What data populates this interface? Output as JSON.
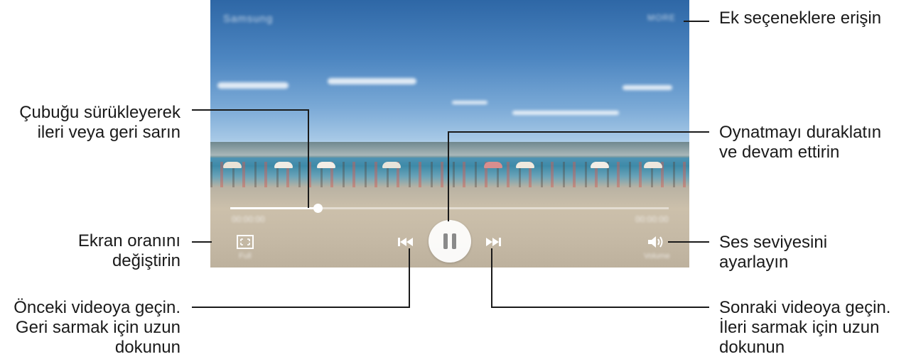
{
  "player": {
    "title": "Samsung",
    "more_label": "MORE",
    "elapsed": "00:00:00",
    "duration": "00:00:00",
    "ratio_label": "Full",
    "volume_label": "Volume",
    "progress_fraction": 0.2
  },
  "callouts": {
    "more": {
      "lines": [
        "Ek seçeneklere erişin"
      ]
    },
    "seek": {
      "lines": [
        "Çubuğu sürükleyerek",
        "ileri veya geri sarın"
      ]
    },
    "pause": {
      "lines": [
        "Oynatmayı duraklatın",
        "ve devam ettirin"
      ]
    },
    "ratio": {
      "lines": [
        "Ekran oranını",
        "değiştirin"
      ]
    },
    "volume": {
      "lines": [
        "Ses seviyesini",
        "ayarlayın"
      ]
    },
    "prev": {
      "lines": [
        "Önceki videoya geçin.",
        "Geri sarmak için uzun",
        "dokunun"
      ]
    },
    "next": {
      "lines": [
        "Sonraki videoya geçin.",
        "İleri sarmak için uzun",
        "dokunun"
      ]
    }
  },
  "icons": {
    "ratio": "screen-ratio-icon",
    "previous": "previous-icon",
    "pause": "pause-icon",
    "next": "next-icon",
    "volume": "volume-icon"
  },
  "colors": {
    "leader_line": "#1a1a1a",
    "control_icon": "#ffffff",
    "pause_bg": "#ffffff"
  }
}
